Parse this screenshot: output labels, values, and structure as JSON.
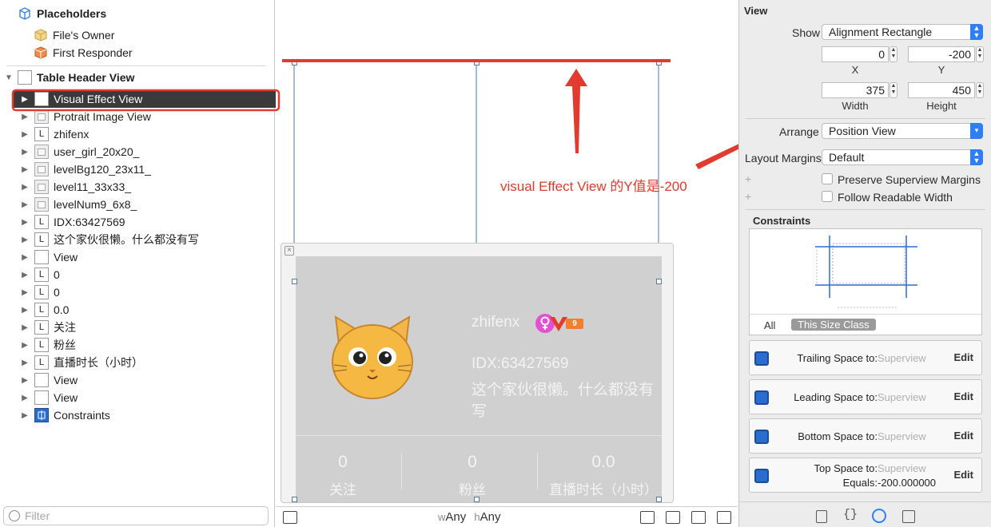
{
  "outline": {
    "placeholders_header": "Placeholders",
    "files_owner": "File's Owner",
    "first_responder": "First Responder",
    "table_header_view": "Table Header View",
    "items": [
      {
        "label": "Visual Effect View",
        "icon": "view-icon",
        "selected": true
      },
      {
        "label": "Protrait Image View",
        "icon": "image-view-icon"
      },
      {
        "label": "zhifenx",
        "icon": "label-icon"
      },
      {
        "label": "user_girl_20x20_",
        "icon": "image-view-icon"
      },
      {
        "label": "levelBg120_23x11_",
        "icon": "image-view-icon"
      },
      {
        "label": "level11_33x33_",
        "icon": "image-view-icon"
      },
      {
        "label": "levelNum9_6x8_",
        "icon": "image-view-icon"
      },
      {
        "label": "IDX:63427569",
        "icon": "label-icon"
      },
      {
        "label": "这个家伙很懒。什么都没有写",
        "icon": "label-icon"
      },
      {
        "label": "View",
        "icon": "view-icon"
      },
      {
        "label": "0",
        "icon": "label-icon"
      },
      {
        "label": "0",
        "icon": "label-icon"
      },
      {
        "label": "0.0",
        "icon": "label-icon"
      },
      {
        "label": "关注",
        "icon": "label-icon"
      },
      {
        "label": "粉丝",
        "icon": "label-icon"
      },
      {
        "label": "直播时长（小时）",
        "icon": "label-icon"
      },
      {
        "label": "View",
        "icon": "view-icon"
      },
      {
        "label": "View",
        "icon": "view-icon"
      },
      {
        "label": "Constraints",
        "icon": "constraints-icon"
      }
    ],
    "label_glyph": "L",
    "filter_placeholder": "Filter"
  },
  "canvas": {
    "username": "zhifenx",
    "vip_badge": "9",
    "idx": "IDX:63427569",
    "signature": "这个家伙很懒。什么都没有写",
    "stats": [
      {
        "value": "0",
        "label": "关注"
      },
      {
        "value": "0",
        "label": "粉丝"
      },
      {
        "value": "0.0",
        "label": "直播时长（小时）"
      }
    ],
    "annotation": "visual Effect View 的Y值是-200",
    "size_class_w_prefix": "w",
    "size_class_w": "Any",
    "size_class_h_prefix": "h",
    "size_class_h": "Any",
    "annotation_color": "#e23a2e"
  },
  "inspector": {
    "section_title": "View",
    "show_label": "Show",
    "show_value": "Alignment Rectangle",
    "x_value": "0",
    "y_value": "-200",
    "x_label": "X",
    "y_label": "Y",
    "width_value": "375",
    "height_value": "450",
    "width_label": "Width",
    "height_label": "Height",
    "arrange_label": "Arrange",
    "arrange_value": "Position View",
    "layout_margins_label": "Layout Margins",
    "layout_margins_value": "Default",
    "preserve_superview_margins": "Preserve Superview Margins",
    "follow_readable_width": "Follow Readable Width",
    "constraints_title": "Constraints",
    "seg_all": "All",
    "seg_size_class": "This Size Class",
    "constraints": [
      {
        "title": "Trailing Space to:",
        "target": "Superview",
        "edit": "Edit"
      },
      {
        "title": "Leading Space to:",
        "target": "Superview",
        "edit": "Edit"
      },
      {
        "title": "Bottom Space to:",
        "target": "Superview",
        "edit": "Edit"
      },
      {
        "title": "Top Space to:",
        "target": "Superview",
        "edit": "Edit",
        "equals_label": "Equals:",
        "equals_value": "-200.000000"
      }
    ],
    "accent": "#2e7ff6"
  }
}
